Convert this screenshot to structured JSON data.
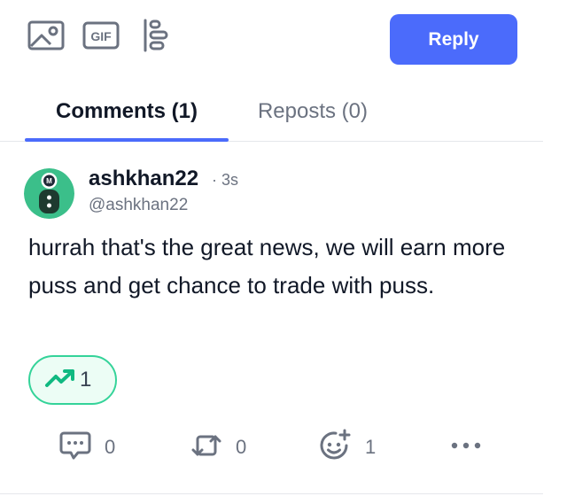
{
  "composer": {
    "icons": [
      "image-icon",
      "gif-icon",
      "poll-icon"
    ],
    "reply_label": "Reply"
  },
  "tabs": [
    {
      "label": "Comments (1)",
      "active": true
    },
    {
      "label": "Reposts (0)",
      "active": false
    }
  ],
  "comment": {
    "username": "ashkhan22",
    "time": "· 3s",
    "handle": "@ashkhan22",
    "body": "hurrah that's the great news, we will earn more puss and get chance to trade with puss.",
    "trend_count": "1",
    "actions": {
      "comments": "0",
      "reposts": "0",
      "reactions": "1"
    }
  },
  "colors": {
    "accent": "#4b6bfb",
    "trend_border": "#34d399",
    "trend_bg": "#ecfdf5",
    "avatar_bg": "#3bbf8a"
  }
}
